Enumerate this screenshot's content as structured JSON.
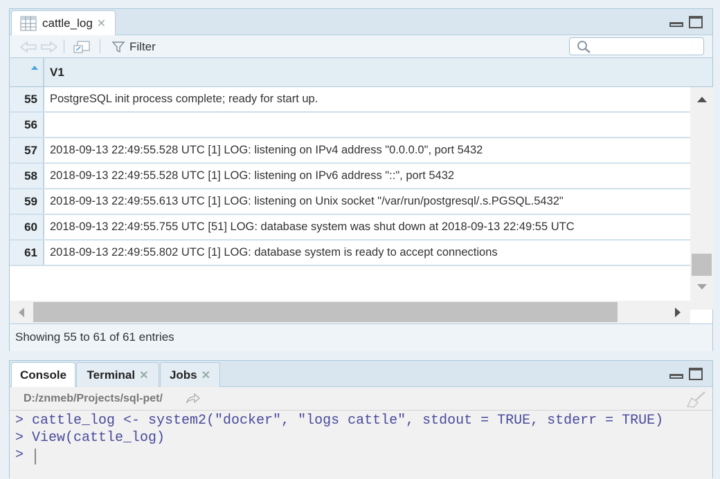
{
  "data_viewer": {
    "tab_label": "cattle_log",
    "filter_label": "Filter",
    "search_placeholder": "",
    "column_header": "V1",
    "rows": [
      {
        "n": "55",
        "v": "PostgreSQL init process complete; ready for start up."
      },
      {
        "n": "56",
        "v": ""
      },
      {
        "n": "57",
        "v": "2018-09-13 22:49:55.528 UTC [1] LOG:  listening on IPv4 address \"0.0.0.0\", port 5432"
      },
      {
        "n": "58",
        "v": "2018-09-13 22:49:55.528 UTC [1] LOG:  listening on IPv6 address \"::\", port 5432"
      },
      {
        "n": "59",
        "v": "2018-09-13 22:49:55.613 UTC [1] LOG:  listening on Unix socket \"/var/run/postgresql/.s.PGSQL.5432\""
      },
      {
        "n": "60",
        "v": "2018-09-13 22:49:55.755 UTC [51] LOG:  database system was shut down at 2018-09-13 22:49:55 UTC"
      },
      {
        "n": "61",
        "v": "2018-09-13 22:49:55.802 UTC [1] LOG:  database system is ready to accept connections"
      }
    ],
    "status_text": "Showing 55 to 61 of 61 entries"
  },
  "console": {
    "tabs": [
      "Console",
      "Terminal",
      "Jobs"
    ],
    "path": "D:/znmeb/Projects/sql-pet/",
    "lines": [
      "> cattle_log <- system2(\"docker\", \"logs cattle\", stdout = TRUE, stderr = TRUE)",
      "> View(cattle_log)",
      "> "
    ]
  },
  "colors": {
    "accent": "#4aa3df",
    "console_text": "#4a4a9c"
  },
  "icons": [
    "table-icon",
    "close-icon",
    "back-arrow-icon",
    "forward-arrow-icon",
    "popout-icon",
    "filter-icon",
    "search-icon",
    "minimize-icon",
    "maximize-icon",
    "sort-asc-icon",
    "scroll-up-icon",
    "scroll-down-icon",
    "scroll-left-icon",
    "scroll-right-icon",
    "navigate-icon",
    "broom-icon"
  ]
}
